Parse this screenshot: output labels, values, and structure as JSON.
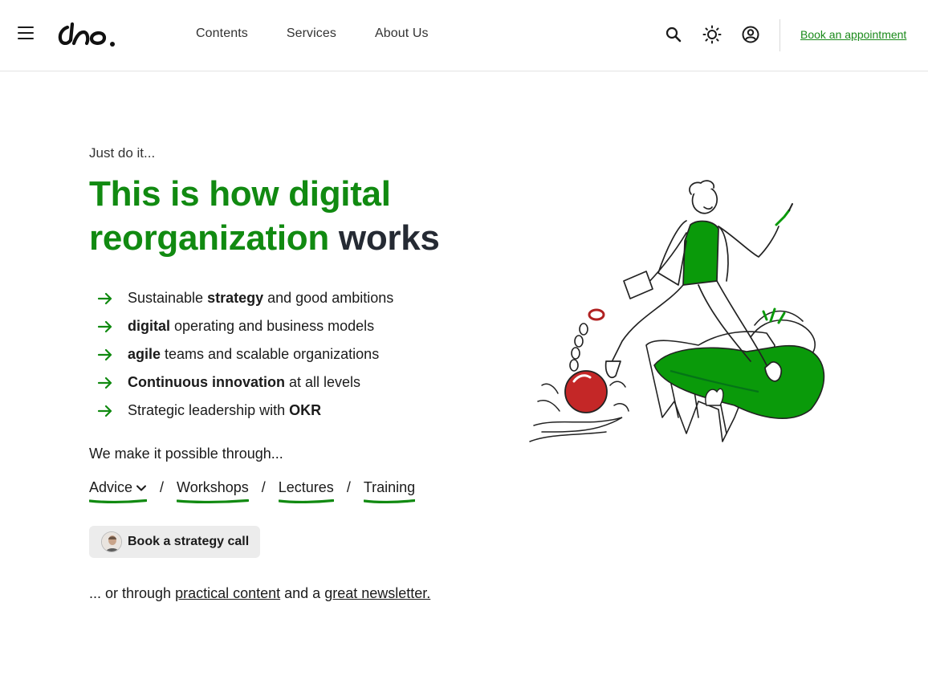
{
  "header": {
    "nav": [
      "Contents",
      "Services",
      "About Us"
    ],
    "book_link": "Book an appointment",
    "icons": [
      "menu-icon",
      "logo",
      "search-icon",
      "sun-icon",
      "account-icon"
    ]
  },
  "hero": {
    "eyebrow": "Just do it...",
    "headline_line1": "This is how digital",
    "headline_line2_green": "reorganization",
    "headline_line2_dark": "works",
    "features": [
      {
        "pre": "Sustainable ",
        "bold": "strategy",
        "post": " and good ambitions"
      },
      {
        "pre": "",
        "bold": "digital",
        "post": " operating and business models"
      },
      {
        "pre": "",
        "bold": "agile",
        "post": " teams and scalable organizations"
      },
      {
        "pre": "",
        "bold": "Continuous innovation",
        "post": " at all levels"
      },
      {
        "pre": "Strategic leadership with ",
        "bold": "OKR",
        "post": ""
      }
    ],
    "make_possible": "We make it possible through...",
    "services": [
      "Advice",
      "Workshops",
      "Lectures",
      "Training"
    ],
    "separator": "/",
    "call_button": "Book a strategy call",
    "footer_pre": "... or through ",
    "footer_link1": "practical content",
    "footer_mid": " and a ",
    "footer_link2": "great newsletter."
  },
  "colors": {
    "accent_green": "#118a11",
    "link_green": "#1a8a1a",
    "dark": "#252a33",
    "illustration_green": "#0a9a0a",
    "illustration_red": "#c42727"
  }
}
